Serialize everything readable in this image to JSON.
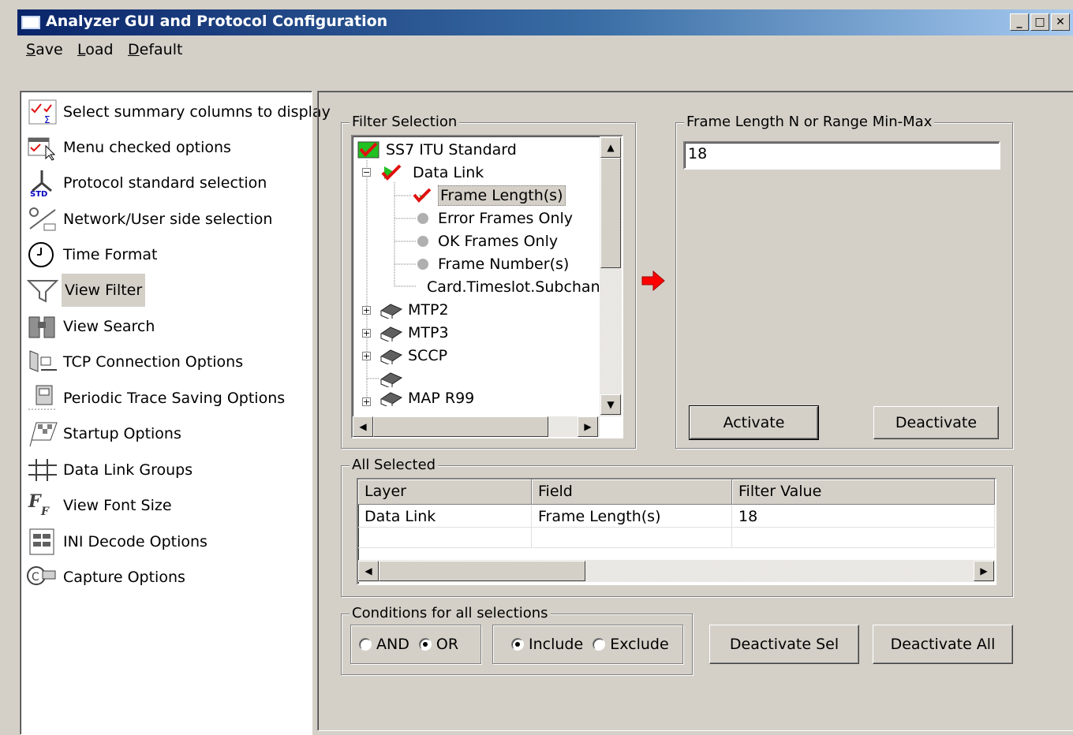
{
  "window": {
    "title": "Analyzer GUI and Protocol Configuration",
    "controls": [
      "_",
      "□",
      "✕"
    ]
  },
  "menu": [
    {
      "accel": "S",
      "rest": "ave"
    },
    {
      "accel": "L",
      "rest": "oad"
    },
    {
      "accel": "D",
      "rest": "efault"
    }
  ],
  "sidebar": {
    "items": [
      {
        "label": "Select summary columns to display",
        "icon": "summary-columns-icon"
      },
      {
        "label": "Menu checked options",
        "icon": "menu-checked-icon"
      },
      {
        "label": "Protocol standard selection",
        "icon": "protocol-std-icon"
      },
      {
        "label": "Network/User side selection",
        "icon": "network-user-icon"
      },
      {
        "label": "Time Format",
        "icon": "clock-icon"
      },
      {
        "label": "View Filter",
        "icon": "funnel-icon",
        "selected": true
      },
      {
        "label": "View Search",
        "icon": "binoculars-icon"
      },
      {
        "label": "TCP Connection Options",
        "icon": "tcp-connection-icon"
      },
      {
        "label": "Periodic Trace Saving Options",
        "icon": "periodic-save-icon"
      },
      {
        "label": "Startup Options",
        "icon": "flag-icon"
      },
      {
        "label": "Data Link Groups",
        "icon": "data-link-groups-icon"
      },
      {
        "label": "View Font Size",
        "icon": "font-size-icon"
      },
      {
        "label": "INI Decode Options",
        "icon": "ini-decode-icon"
      },
      {
        "label": "Capture Options",
        "icon": "capture-icon"
      }
    ]
  },
  "filter_selection": {
    "legend": "Filter Selection",
    "tree": {
      "root": "SS7 ITU Standard",
      "data_link": "Data Link",
      "data_link_children": [
        "Frame Length(s)",
        "Error Frames Only",
        "OK Frames Only",
        "Frame Number(s)",
        "Card.Timeslot.Subchan"
      ],
      "others": [
        "MTP2",
        "MTP3",
        "SCCP",
        "",
        "MAP R99"
      ]
    }
  },
  "frame_length": {
    "legend": "Frame Length N or Range Min-Max",
    "value": "18",
    "activate": "Activate",
    "deactivate": "Deactivate"
  },
  "all_selected": {
    "legend": "All Selected",
    "columns": [
      "Layer",
      "Field",
      "Filter Value"
    ],
    "rows": [
      [
        "Data Link",
        "Frame Length(s)",
        "18"
      ]
    ]
  },
  "conditions": {
    "legend": "Conditions for all selections",
    "and": "AND",
    "or": "OR",
    "include": "Include",
    "exclude": "Exclude",
    "logic_selected": "OR",
    "mode_selected": "Include"
  },
  "actions": {
    "deactivate_sel": "Deactivate Sel",
    "deactivate_all": "Deactivate All"
  },
  "colors": {
    "title_start": "#0a246a",
    "title_end": "#a6caf0",
    "face": "#d4d0c8",
    "check_red": "#e01010",
    "check_green": "#20c020",
    "arrow_red": "#ff0000"
  }
}
